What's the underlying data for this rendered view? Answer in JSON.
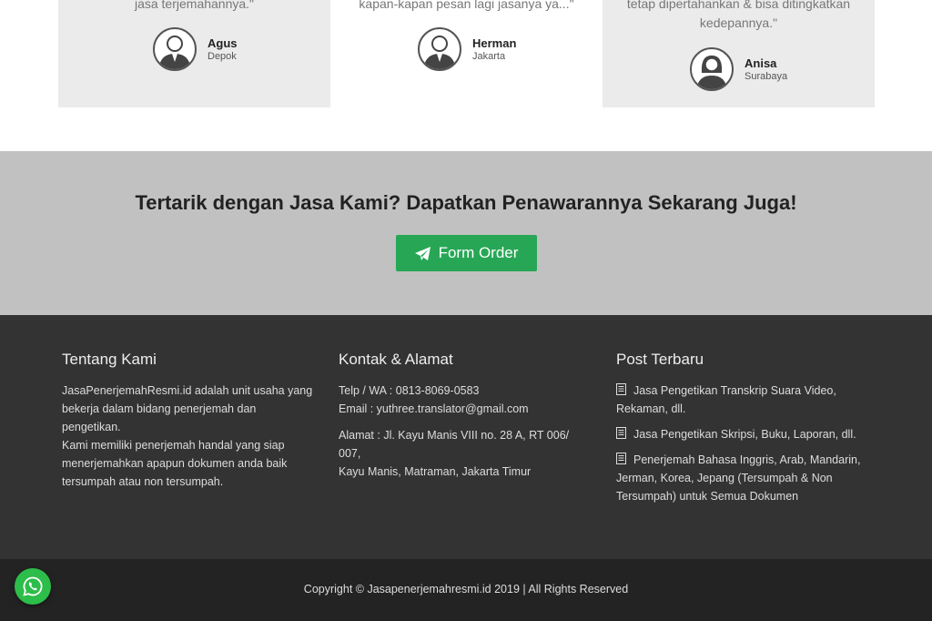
{
  "testimonials": [
    {
      "quote": "jasa terjemahannya.\"",
      "name": "Agus",
      "city": "Depok",
      "gender": "male"
    },
    {
      "quote": "kapan-kapan pesan lagi jasanya ya...\"",
      "name": "Herman",
      "city": "Jakarta",
      "gender": "male"
    },
    {
      "quote_line1": "tetap dipertahankan & bisa ditingkatkan",
      "quote_line2": "kedepannya.\"",
      "name": "Anisa",
      "city": "Surabaya",
      "gender": "female"
    }
  ],
  "cta": {
    "title": "Tertarik dengan Jasa Kami? Dapatkan Penawarannya Sekarang Juga!",
    "button_label": "Form Order"
  },
  "footer": {
    "about": {
      "heading": "Tentang Kami",
      "lines": [
        "JasaPenerjemahResmi.id adalah unit usaha yang",
        "bekerja dalam bidang penerjemah dan pengetikan.",
        "Kami memiliki penerjemah handal yang siap",
        "menerjemahkan apapun dokumen anda baik",
        "tersumpah atau non tersumpah."
      ]
    },
    "contact": {
      "heading": "Kontak & Alamat",
      "phone": "Telp / WA : 0813-8069-0583",
      "email": "Email : yuthree.translator@gmail.com",
      "address_line1": "Alamat : Jl. Kayu Manis VIII no. 28 A, RT 006/ 007,",
      "address_line2": "Kayu Manis, Matraman, Jakarta Timur"
    },
    "posts": {
      "heading": "Post Terbaru",
      "items": [
        {
          "line1": "Jasa Pengetikan Transkrip Suara Video,",
          "line2": "Rekaman, dll."
        },
        {
          "line1": "Jasa Pengetikan Skripsi, Buku, Laporan, dll.",
          "line2": ""
        },
        {
          "line1": "Penerjemah Bahasa Inggris, Arab, Mandarin,",
          "line2": "Jerman, Korea, Jepang (Tersumpah & Non",
          "line3": "Tersumpah) untuk Semua Dokumen"
        }
      ]
    },
    "copyright": "Copyright © Jasapenerjemahresmi.id 2019 | All Rights Reserved"
  },
  "colors": {
    "cta_bg": "#c1c1c1",
    "button": "#27a755",
    "footer_bg": "#333334",
    "bottom_bg": "#232324",
    "whatsapp": "#2dbd4a"
  }
}
